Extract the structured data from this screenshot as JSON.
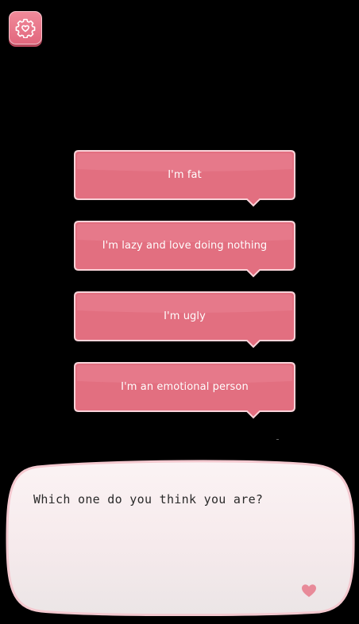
{
  "settings": {
    "icon": "gear-heart-icon"
  },
  "choices": [
    {
      "label": "I'm fat"
    },
    {
      "label": "I'm lazy and love doing nothing"
    },
    {
      "label": "I'm ugly"
    },
    {
      "label": "I'm an emotional person"
    }
  ],
  "dialog": {
    "text": "Which one do you think you are?",
    "indicator_icon": "heart-icon"
  },
  "colors": {
    "button_pink": "#e26f80",
    "button_border": "#f9d3d9",
    "dialog_bg": "#f6eaec",
    "dialog_border": "#f4c9d0",
    "heart": "#e88a99"
  }
}
